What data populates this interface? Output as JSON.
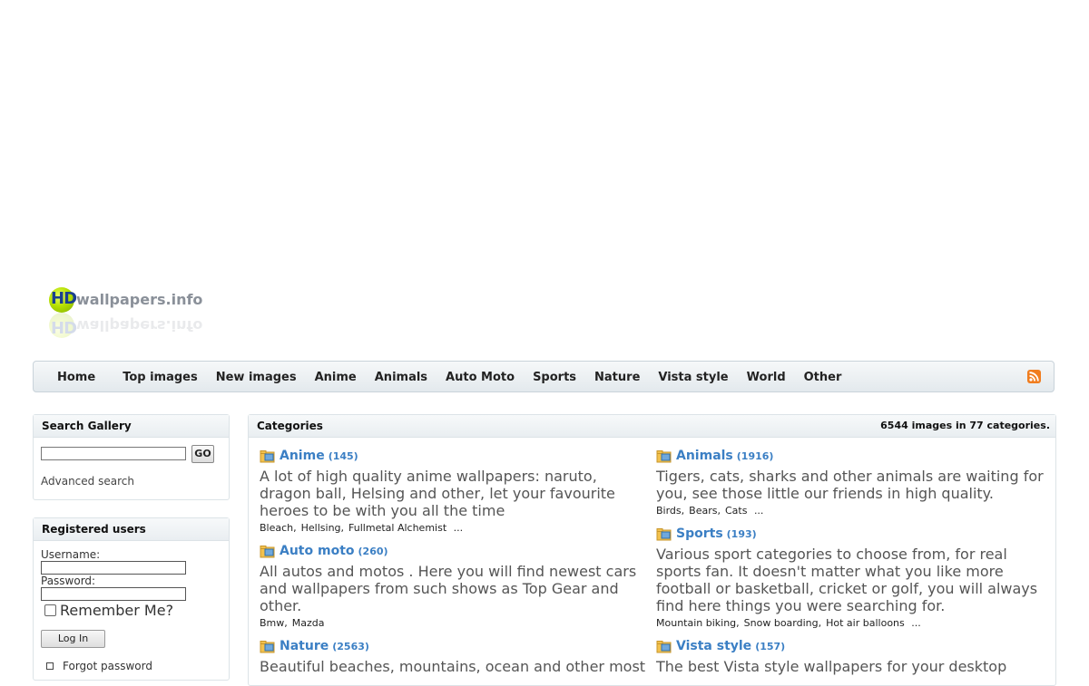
{
  "logo": {
    "hd": "HD",
    "text": "wallpapers.info"
  },
  "nav": {
    "items": [
      "Home",
      "Top images",
      "New images",
      "Anime",
      "Animals",
      "Auto Moto",
      "Sports",
      "Nature",
      "Vista style",
      "World",
      "Other"
    ]
  },
  "search": {
    "title": "Search Gallery",
    "go_label": "GO",
    "advanced_label": "Advanced search"
  },
  "login": {
    "title": "Registered users",
    "username_label": "Username:",
    "password_label": "Password:",
    "remember_label": "Remember Me?",
    "login_label": "Log In",
    "forgot_label": "Forgot password"
  },
  "categories": {
    "title": "Categories",
    "summary": "6544 images in 77 categories.",
    "items": [
      {
        "name": "Anime",
        "count": "(145)",
        "desc": "A lot of high quality anime wallpapers: naruto, dragon ball, Helsing and other, let your favourite heroes to be with you all the time",
        "subs": [
          "Bleach",
          "Hellsing",
          "Fullmetal Alchemist"
        ],
        "more": "..."
      },
      {
        "name": "Animals",
        "count": "(1916)",
        "desc": "Tigers, cats, sharks and other animals are waiting for you, see those little our friends in high quality.",
        "subs": [
          "Birds",
          "Bears",
          "Cats"
        ],
        "more": "..."
      },
      {
        "name": "Auto moto",
        "count": "(260)",
        "desc": "All autos and motos . Here you will find newest cars and wallpapers from such shows as Top Gear and other.",
        "subs": [
          "Bmw",
          "Mazda"
        ],
        "more": ""
      },
      {
        "name": "Sports",
        "count": "(193)",
        "desc": "Various sport categories to choose from, for real sports fan. It doesn't matter what you like more football or basketball, cricket or golf, you will always find here things you were searching for.",
        "subs": [
          "Mountain biking",
          "Snow boarding",
          "Hot air balloons"
        ],
        "more": "..."
      },
      {
        "name": "Nature",
        "count": "(2563)",
        "desc": "Beautiful beaches, mountains, ocean and other most",
        "subs": [],
        "more": ""
      },
      {
        "name": "Vista style",
        "count": "(157)",
        "desc": "The best Vista style wallpapers for your desktop",
        "subs": [],
        "more": ""
      }
    ]
  }
}
